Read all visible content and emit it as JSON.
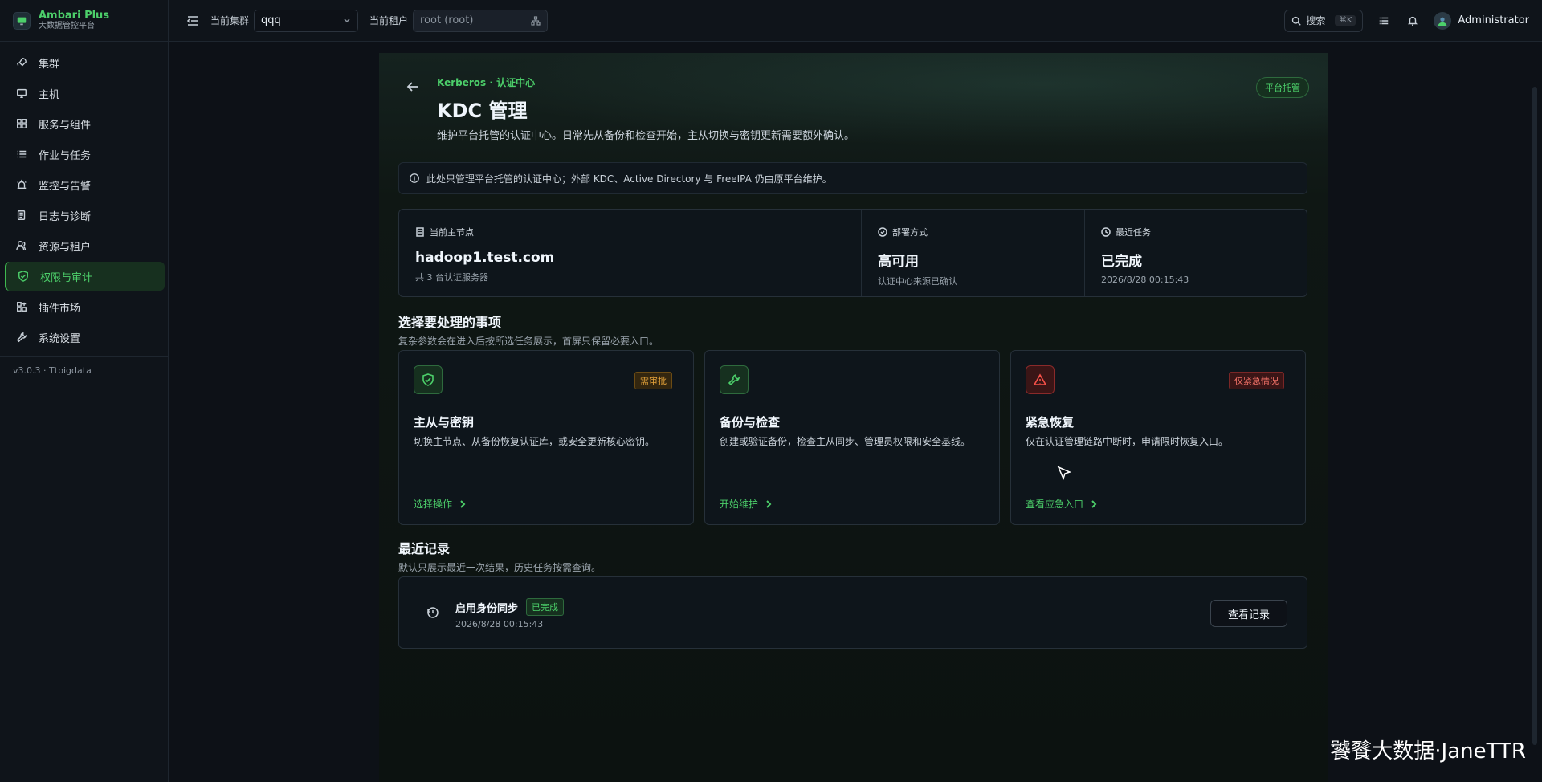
{
  "brand": {
    "title": "Ambari Plus",
    "subtitle": "大数据管控平台"
  },
  "sidebar": {
    "items": [
      {
        "label": "集群",
        "icon": "rocket-icon"
      },
      {
        "label": "主机",
        "icon": "monitor-icon"
      },
      {
        "label": "服务与组件",
        "icon": "grid-icon"
      },
      {
        "label": "作业与任务",
        "icon": "list-icon"
      },
      {
        "label": "监控与告警",
        "icon": "alarm-icon"
      },
      {
        "label": "日志与诊断",
        "icon": "log-icon"
      },
      {
        "label": "资源与租户",
        "icon": "users-icon"
      },
      {
        "label": "权限与审计",
        "icon": "shield-icon",
        "active": true
      },
      {
        "label": "插件市场",
        "icon": "plugin-icon"
      },
      {
        "label": "系统设置",
        "icon": "wrench-icon"
      }
    ],
    "version": "v3.0.3 · Ttbigdata"
  },
  "topbar": {
    "cluster_label": "当前集群",
    "cluster_value": "qqq",
    "tenant_label": "当前租户",
    "tenant_value": "root (root)",
    "search_label": "搜索",
    "search_kbd": "⌘K",
    "user_name": "Administrator"
  },
  "header": {
    "breadcrumb": "Kerberos · 认证中心",
    "title": "KDC 管理",
    "description": "维护平台托管的认证中心。日常先从备份和检查开始，主从切换与密钥更新需要额外确认。",
    "tag": "平台托管"
  },
  "notice": "此处只管理平台托管的认证中心；外部 KDC、Active Directory 与 FreeIPA 仍由原平台维护。",
  "stats": [
    {
      "label": "当前主节点",
      "value": "hadoop1.test.com",
      "sub": "共 3 台认证服务器"
    },
    {
      "label": "部署方式",
      "value": "高可用",
      "sub": "认证中心来源已确认"
    },
    {
      "label": "最近任务",
      "value": "已完成",
      "sub": "2026/8/28 00:15:43"
    }
  ],
  "actions_section": {
    "title": "选择要处理的事项",
    "description": "复杂参数会在进入后按所选任务展示，首屏只保留必要入口。"
  },
  "cards": [
    {
      "title": "主从与密钥",
      "badge": "需审批",
      "desc": "切换主节点、从备份恢复认证库，或安全更新核心密钥。",
      "link": "选择操作"
    },
    {
      "title": "备份与检查",
      "badge": "",
      "desc": "创建或验证备份，检查主从同步、管理员权限和安全基线。",
      "link": "开始维护"
    },
    {
      "title": "紧急恢复",
      "badge": "仅紧急情况",
      "desc": "仅在认证管理链路中断时，申请限时恢复入口。",
      "link": "查看应急入口"
    }
  ],
  "records_section": {
    "title": "最近记录",
    "description": "默认只展示最近一次结果，历史任务按需查询。"
  },
  "record": {
    "title": "启用身份同步",
    "badge": "已完成",
    "time": "2026/8/28 00:15:43",
    "button": "查看记录"
  },
  "watermark": "饕餮大数据·JaneTTR",
  "colors": {
    "accent": "#4ccf6a",
    "warning": "#e3a23a",
    "danger": "#f85149",
    "background": "#0d1117"
  }
}
